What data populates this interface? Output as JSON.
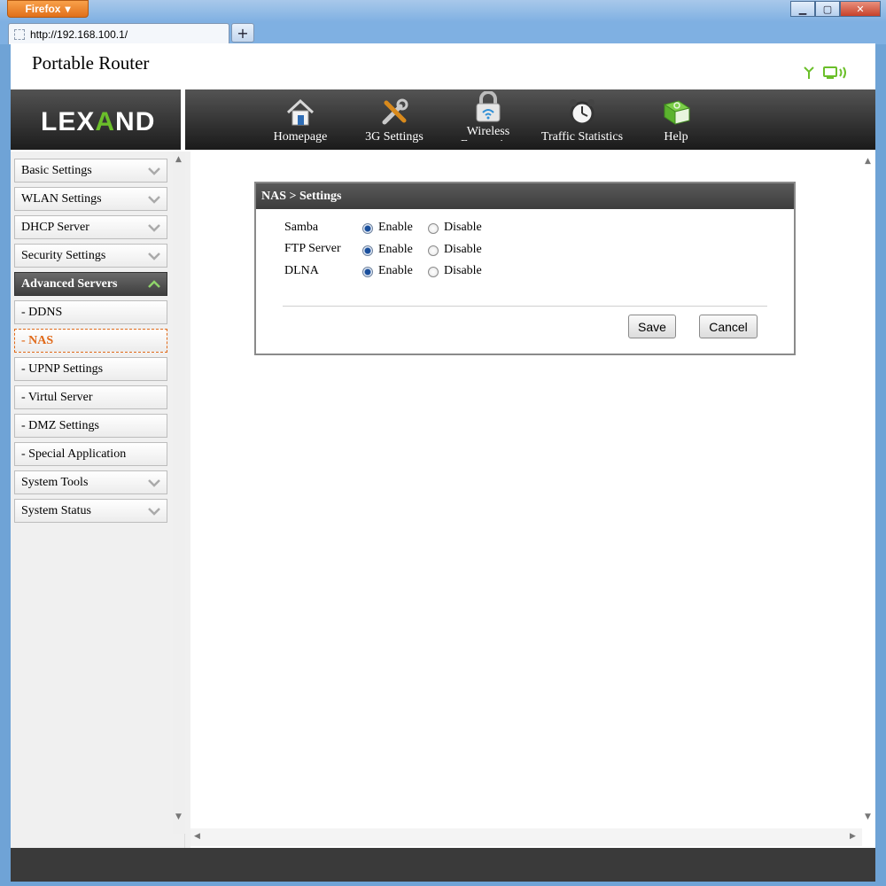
{
  "browser": {
    "menu_label": "Firefox",
    "tab_url": "http://192.168.100.1/",
    "new_tab": "+",
    "window_controls": [
      "minimize-icon",
      "maximize-icon",
      "close-icon"
    ]
  },
  "header": {
    "title": "Portable Router",
    "status_icons": [
      "signal-icon",
      "device-connected-icon"
    ]
  },
  "logo": {
    "text_left": "LEX",
    "text_dot": "A",
    "text_right": "ND"
  },
  "nav": [
    {
      "label": "Homepage",
      "icon": "home-icon"
    },
    {
      "label": "3G Settings",
      "icon": "tools-icon"
    },
    {
      "label": "Wireless Encryption",
      "icon": "wifi-lock-icon"
    },
    {
      "label": "Traffic Statistics",
      "icon": "alarm-clock-icon"
    },
    {
      "label": "Help",
      "icon": "help-book-icon"
    }
  ],
  "sidebar": {
    "items": [
      {
        "label": "Basic Settings"
      },
      {
        "label": "WLAN Settings"
      },
      {
        "label": "DHCP Server"
      },
      {
        "label": "Security Settings"
      },
      {
        "label": "Advanced Servers"
      },
      {
        "label": "- DDNS"
      },
      {
        "label": "- NAS"
      },
      {
        "label": "- UPNP Settings"
      },
      {
        "label": "- Virtul Server"
      },
      {
        "label": "- DMZ Settings"
      },
      {
        "label": "- Special Application"
      },
      {
        "label": "System Tools"
      },
      {
        "label": "System Status"
      }
    ]
  },
  "panel": {
    "title": "NAS > Settings",
    "rows": [
      {
        "label": "Samba",
        "enable": "Enable",
        "disable": "Disable",
        "selected": "Enable"
      },
      {
        "label": "FTP Server",
        "enable": "Enable",
        "disable": "Disable",
        "selected": "Enable"
      },
      {
        "label": "DLNA",
        "enable": "Enable",
        "disable": "Disable",
        "selected": "Enable"
      }
    ],
    "save_label": "Save",
    "cancel_label": "Cancel"
  },
  "colors": {
    "accent_active": "#e06a1a",
    "nav_bg": "#2a2a2a",
    "logo_dot": "#6bbf2a"
  }
}
